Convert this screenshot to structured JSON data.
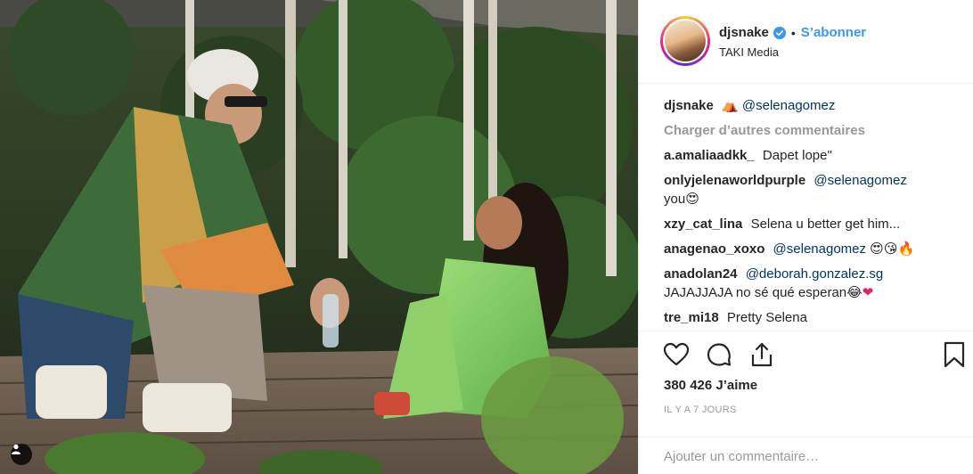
{
  "post": {
    "photo_alt": ""
  },
  "header": {
    "username": "djsnake",
    "separator": "•",
    "follow_label": "S’abonner",
    "location": "TAKI Media"
  },
  "caption": {
    "username": "djsnake",
    "emoji": "⛺",
    "mention": "@selenagomez"
  },
  "load_more": "Charger d’autres commentaires",
  "comments": [
    {
      "user": "a.amaliaadkk_",
      "text": "Dapet lope\""
    },
    {
      "user": "onlyjelenaworldpurple",
      "mention": "@selenagomez",
      "text": "you",
      "emojis": [
        "😍"
      ]
    },
    {
      "user": "xzy_cat_lina",
      "text": "Selena u better get him..."
    },
    {
      "user": "anagenao_xoxo",
      "mention": "@selenagomez",
      "emojis": [
        "😍",
        "😘",
        "🔥"
      ]
    },
    {
      "user": "anadolan24",
      "mention": "@deborah.gonzalez.sg",
      "text": "JAJAJJAJA no sé qué esperan",
      "emojis": [
        "😂",
        "❤"
      ]
    },
    {
      "user": "tre_mi18",
      "text": "Pretty Selena"
    }
  ],
  "likes": "380 426 J’aime",
  "timestamp": "IL Y A 7 JOURS",
  "add_comment_placeholder": "Ajouter un commentaire…",
  "colors": {
    "link": "#3897f0",
    "mention": "#003569",
    "muted": "#999999",
    "text": "#262626",
    "divider": "#efefef"
  },
  "icons": [
    "verified-icon",
    "heart-icon",
    "comment-icon",
    "share-icon",
    "bookmark-icon",
    "tag-people-icon"
  ]
}
